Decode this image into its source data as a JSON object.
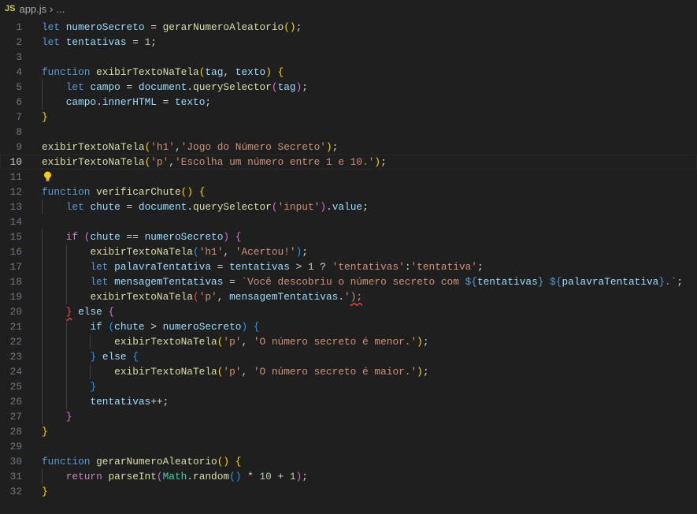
{
  "breadcrumb": {
    "file_icon": "JS",
    "file": "app.js",
    "separator": "›",
    "more": "..."
  },
  "editor": {
    "current_line": 10,
    "lightbulb_line": 11,
    "lines": [
      [
        [
          "kw",
          "let"
        ],
        [
          "op",
          " "
        ],
        [
          "var",
          "numeroSecreto"
        ],
        [
          "op",
          " = "
        ],
        [
          "fn",
          "gerarNumeroAleatorio"
        ],
        [
          "b1",
          "()"
        ],
        [
          "op",
          ";"
        ]
      ],
      [
        [
          "kw",
          "let"
        ],
        [
          "op",
          " "
        ],
        [
          "var",
          "tentativas"
        ],
        [
          "op",
          " = "
        ],
        [
          "num",
          "1"
        ],
        [
          "op",
          ";"
        ]
      ],
      [],
      [
        [
          "kw",
          "function"
        ],
        [
          "op",
          " "
        ],
        [
          "fn",
          "exibirTextoNaTela"
        ],
        [
          "b1",
          "("
        ],
        [
          "var",
          "tag"
        ],
        [
          "op",
          ", "
        ],
        [
          "var",
          "texto"
        ],
        [
          "b1",
          ")"
        ],
        [
          "op",
          " "
        ],
        [
          "b1",
          "{"
        ]
      ],
      [
        [
          "op",
          "    "
        ],
        [
          "kw",
          "let"
        ],
        [
          "op",
          " "
        ],
        [
          "var",
          "campo"
        ],
        [
          "op",
          " = "
        ],
        [
          "var",
          "document"
        ],
        [
          "op",
          "."
        ],
        [
          "fn",
          "querySelector"
        ],
        [
          "b2",
          "("
        ],
        [
          "var",
          "tag"
        ],
        [
          "b2",
          ")"
        ],
        [
          "op",
          ";"
        ]
      ],
      [
        [
          "op",
          "    "
        ],
        [
          "var",
          "campo"
        ],
        [
          "op",
          "."
        ],
        [
          "var",
          "innerHTML"
        ],
        [
          "op",
          " = "
        ],
        [
          "var",
          "texto"
        ],
        [
          "op",
          ";"
        ]
      ],
      [
        [
          "b1",
          "}"
        ]
      ],
      [],
      [
        [
          "fn",
          "exibirTextoNaTela"
        ],
        [
          "b1",
          "("
        ],
        [
          "str",
          "'h1'"
        ],
        [
          "op",
          ","
        ],
        [
          "str",
          "'Jogo do Número Secreto'"
        ],
        [
          "b1",
          ")"
        ],
        [
          "op",
          ";"
        ]
      ],
      [
        [
          "fn",
          "exibirTextoNaTela"
        ],
        [
          "b1",
          "("
        ],
        [
          "str",
          "'p'"
        ],
        [
          "op",
          ","
        ],
        [
          "str",
          "'Escolha um número entre 1 e 10.'"
        ],
        [
          "b1",
          ")"
        ],
        [
          "op",
          ";"
        ]
      ],
      [],
      [
        [
          "kw",
          "function"
        ],
        [
          "op",
          " "
        ],
        [
          "fn",
          "verificarChute"
        ],
        [
          "b1",
          "()"
        ],
        [
          "op",
          " "
        ],
        [
          "b1",
          "{"
        ]
      ],
      [
        [
          "op",
          "    "
        ],
        [
          "kw",
          "let"
        ],
        [
          "op",
          " "
        ],
        [
          "var",
          "chute"
        ],
        [
          "op",
          " = "
        ],
        [
          "var",
          "document"
        ],
        [
          "op",
          "."
        ],
        [
          "fn",
          "querySelector"
        ],
        [
          "b2",
          "("
        ],
        [
          "str",
          "'input'"
        ],
        [
          "b2",
          ")"
        ],
        [
          "op",
          "."
        ],
        [
          "var",
          "value"
        ],
        [
          "op",
          ";"
        ]
      ],
      [],
      [
        [
          "op",
          "    "
        ],
        [
          "ctl",
          "if"
        ],
        [
          "op",
          " "
        ],
        [
          "b2",
          "("
        ],
        [
          "var",
          "chute"
        ],
        [
          "op",
          " == "
        ],
        [
          "var",
          "numeroSecreto"
        ],
        [
          "b2",
          ")"
        ],
        [
          "op",
          " "
        ],
        [
          "b2",
          "{"
        ]
      ],
      [
        [
          "op",
          "        "
        ],
        [
          "fn",
          "exibirTextoNaTela"
        ],
        [
          "b3",
          "("
        ],
        [
          "str",
          "'h1'"
        ],
        [
          "op",
          ", "
        ],
        [
          "str",
          "'Acertou!'"
        ],
        [
          "b3",
          ")"
        ],
        [
          "op",
          ";"
        ]
      ],
      [
        [
          "op",
          "        "
        ],
        [
          "kw",
          "let"
        ],
        [
          "op",
          " "
        ],
        [
          "var",
          "palavraTentativa"
        ],
        [
          "op",
          " = "
        ],
        [
          "var",
          "tentativas"
        ],
        [
          "op",
          " > "
        ],
        [
          "num",
          "1"
        ],
        [
          "op",
          " ? "
        ],
        [
          "str",
          "'tentativas'"
        ],
        [
          "op",
          ":"
        ],
        [
          "str",
          "'tentativa'"
        ],
        [
          "op",
          ";"
        ]
      ],
      [
        [
          "op",
          "        "
        ],
        [
          "kw",
          "let"
        ],
        [
          "op",
          " "
        ],
        [
          "var",
          "mensagemTentativas"
        ],
        [
          "op",
          " = "
        ],
        [
          "str",
          "`Você descobriu o número secreto com "
        ],
        [
          "tpl",
          "${"
        ],
        [
          "var",
          "tentativas"
        ],
        [
          "tpl",
          "}"
        ],
        [
          "str",
          " "
        ],
        [
          "tpl",
          "${"
        ],
        [
          "var",
          "palavraTentativa"
        ],
        [
          "tpl",
          "}"
        ],
        [
          "str",
          ".`"
        ],
        [
          "op",
          ";"
        ]
      ],
      [
        [
          "op",
          "        "
        ],
        [
          "fn",
          "exibirTextoNaTela"
        ],
        [
          "err",
          "("
        ],
        [
          "str",
          "'p'"
        ],
        [
          "op",
          ", "
        ],
        [
          "var",
          "mensagemTentativas"
        ],
        [
          "op",
          "."
        ],
        [
          "str",
          "'"
        ],
        [
          "str sq",
          ");"
        ]
      ],
      [
        [
          "op",
          "    "
        ],
        [
          "errsq",
          "}"
        ],
        [
          "op",
          " "
        ],
        [
          "var",
          "else"
        ],
        [
          "op",
          " "
        ],
        [
          "b2",
          "{"
        ]
      ],
      [
        [
          "op",
          "        "
        ],
        [
          "var",
          "if"
        ],
        [
          "op",
          " "
        ],
        [
          "b3",
          "("
        ],
        [
          "var",
          "chute"
        ],
        [
          "op",
          " > "
        ],
        [
          "var",
          "numeroSecreto"
        ],
        [
          "b3",
          ")"
        ],
        [
          "op",
          " "
        ],
        [
          "b3",
          "{"
        ]
      ],
      [
        [
          "op",
          "            "
        ],
        [
          "fn",
          "exibirTextoNaTela"
        ],
        [
          "b1",
          "("
        ],
        [
          "str",
          "'p'"
        ],
        [
          "op",
          ", "
        ],
        [
          "str",
          "'O número secreto é menor.'"
        ],
        [
          "b1",
          ")"
        ],
        [
          "op",
          ";"
        ]
      ],
      [
        [
          "op",
          "        "
        ],
        [
          "b3",
          "}"
        ],
        [
          "op",
          " "
        ],
        [
          "var",
          "else"
        ],
        [
          "op",
          " "
        ],
        [
          "b3",
          "{"
        ]
      ],
      [
        [
          "op",
          "            "
        ],
        [
          "fn",
          "exibirTextoNaTela"
        ],
        [
          "b1",
          "("
        ],
        [
          "str",
          "'p'"
        ],
        [
          "op",
          ", "
        ],
        [
          "str",
          "'O número secreto é maior.'"
        ],
        [
          "b1",
          ")"
        ],
        [
          "op",
          ";"
        ]
      ],
      [
        [
          "op",
          "        "
        ],
        [
          "b3",
          "}"
        ]
      ],
      [
        [
          "op",
          "        "
        ],
        [
          "var",
          "tentativas"
        ],
        [
          "op",
          "++;"
        ]
      ],
      [
        [
          "op",
          "    "
        ],
        [
          "b2",
          "}"
        ]
      ],
      [
        [
          "b1",
          "}"
        ]
      ],
      [],
      [
        [
          "kw",
          "function"
        ],
        [
          "op",
          " "
        ],
        [
          "fn",
          "gerarNumeroAleatorio"
        ],
        [
          "b1",
          "()"
        ],
        [
          "op",
          " "
        ],
        [
          "b1",
          "{"
        ]
      ],
      [
        [
          "op",
          "    "
        ],
        [
          "ctl",
          "return"
        ],
        [
          "op",
          " "
        ],
        [
          "fn",
          "parseInt"
        ],
        [
          "b2",
          "("
        ],
        [
          "cls",
          "Math"
        ],
        [
          "op",
          "."
        ],
        [
          "fn",
          "random"
        ],
        [
          "b3",
          "()"
        ],
        [
          "op",
          " * "
        ],
        [
          "num",
          "10"
        ],
        [
          "op",
          " + "
        ],
        [
          "num",
          "1"
        ],
        [
          "b2",
          ")"
        ],
        [
          "op",
          ";"
        ]
      ],
      [
        [
          "b1",
          "}"
        ]
      ]
    ]
  },
  "colors": {
    "background": "#1f1f1f",
    "keyword": "#569cd6",
    "control": "#c586c0",
    "variable": "#9cdcfe",
    "function": "#dcdcaa",
    "string": "#ce9178",
    "number": "#b5cea8",
    "bracket1": "#ffd700",
    "bracket2": "#da70d6",
    "bracket3": "#179fff",
    "error": "#f44747"
  }
}
